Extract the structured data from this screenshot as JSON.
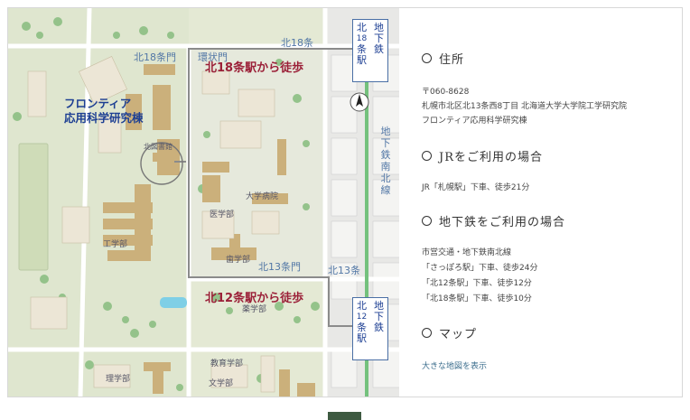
{
  "map": {
    "campus_title_line1": "フロンティア",
    "campus_title_line2": "応用科学研究棟",
    "walk_n18": "北18条駅から徒歩",
    "walk_n12": "北12条駅から徒歩",
    "station_n18": [
      "北",
      "18",
      "条",
      "駅"
    ],
    "station_n18_sub": [
      "地",
      "下",
      "鉄"
    ],
    "station_n12": [
      "北",
      "12",
      "条",
      "駅"
    ],
    "station_n12_sub": [
      "地",
      "下",
      "鉄"
    ],
    "subway_line_label": [
      "地",
      "下",
      "鉄",
      "南",
      "北",
      "線"
    ],
    "street_n18": "北18条",
    "street_n13": "北13条",
    "gate_n18": "北18条門",
    "gate_kanjo": "環状門",
    "gate_n13": "北13条門",
    "label_library": "北図書館",
    "label_hospital": "大学病院",
    "label_medicine": "医学部",
    "label_dentistry": "歯学部",
    "label_pharmacy": "薬学部",
    "label_engineering": "工学部",
    "label_science": "理学部",
    "label_education": "教育学部",
    "label_letters": "文学部",
    "colors": {
      "accent_blue": "#1d3f93",
      "accent_red": "#9b2038",
      "subway_green": "#74c17d",
      "building_tan": "#cbb07b",
      "road_gray": "#8b8b8b"
    }
  },
  "info": {
    "address": {
      "title": "住所",
      "postal": "〒060-8628",
      "line1": "札幌市北区北13条西8丁目 北海道大学大学院工学研究院",
      "line2": "フロンティア応用科学研究棟"
    },
    "jr": {
      "title": "JRをご利用の場合",
      "line1": "JR「札幌駅」下車、徒歩21分"
    },
    "subway": {
      "title": "地下鉄をご利用の場合",
      "line1": "市営交通・地下鉄南北線",
      "line2": "「さっぽろ駅」下車、徒歩24分",
      "line3": "「北12条駅」下車、徒歩12分",
      "line4": "「北18条駅」下車、徒歩10分"
    },
    "map": {
      "title": "マップ",
      "link": "大きな地図を表示"
    }
  }
}
